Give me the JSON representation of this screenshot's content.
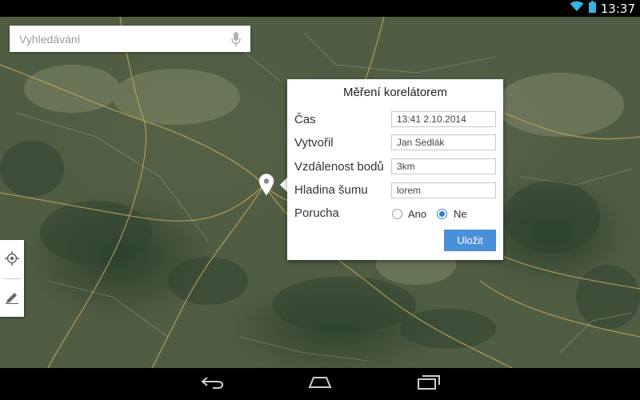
{
  "status_bar": {
    "time": "13:37",
    "wifi_icon": "wifi-icon",
    "battery_icon": "battery-icon"
  },
  "search": {
    "placeholder": "Vyhledávání",
    "mic_icon": "microphone-icon"
  },
  "tools": [
    {
      "name": "my-location",
      "icon": "crosshair-icon"
    },
    {
      "name": "edit",
      "icon": "pencil-icon"
    }
  ],
  "dialog": {
    "title": "Měření korelátorem",
    "fields": [
      {
        "label": "Čas",
        "value": "13:41 2.10.2014"
      },
      {
        "label": "Vytvořil",
        "value": "Jan Sedlák"
      },
      {
        "label": "Vzdálenost bodů",
        "value": "3km"
      },
      {
        "label": "Hladina šumu",
        "value": "lorem"
      }
    ],
    "fault": {
      "label": "Porucha",
      "options": [
        {
          "label": "Ano",
          "selected": false
        },
        {
          "label": "Ne",
          "selected": true
        }
      ]
    },
    "save_label": "Uložit",
    "accent_color": "#4a90d9"
  },
  "nav": {
    "back_icon": "back-icon",
    "home_icon": "home-icon",
    "recents_icon": "recent-apps-icon"
  }
}
